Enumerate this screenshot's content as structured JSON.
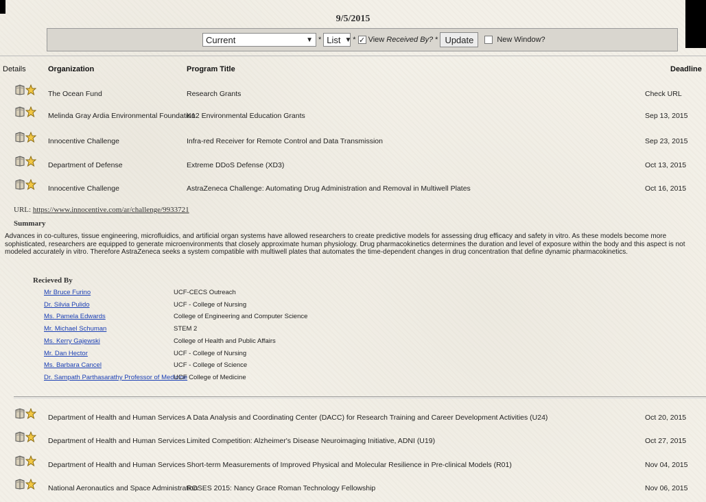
{
  "date": "9/5/2015",
  "toolbar": {
    "filter_value": "Current",
    "view_value": "List",
    "asterisk": "*",
    "view_received_label": "View",
    "view_received_italic": "Received By?",
    "update_label": "Update",
    "new_window_label": "New Window?"
  },
  "headers": {
    "details": "Details",
    "organization": "Organization",
    "program_title": "Program Title",
    "deadline": "Deadline"
  },
  "rows_top": [
    {
      "org": "The Ocean Fund",
      "title": "Research Grants",
      "deadline": "Check URL"
    },
    {
      "org": "Melinda Gray Ardia Environmental Foundation",
      "title": "K12 Environmental Education Grants",
      "deadline": "Sep 13, 2015"
    },
    {
      "org": "Innocentive Challenge",
      "title": "Infra-red Receiver for Remote Control and Data Transmission",
      "deadline": "Sep 23, 2015"
    },
    {
      "org": "Department of Defense",
      "title": "Extreme DDoS Defense (XD3)",
      "deadline": "Oct 13, 2015"
    },
    {
      "org": "Innocentive Challenge",
      "title": "AstraZeneca Challenge: Automating Drug Administration and Removal in Multiwell Plates",
      "deadline": "Oct 16, 2015"
    }
  ],
  "detail": {
    "url_label": "URL:",
    "url": "https://www.innocentive.com/ar/challenge/9933721",
    "summary_heading": "Summary",
    "summary": "Advances in co-cultures, tissue engineering, microfluidics, and artificial organ systems have allowed researchers to create predictive models for assessing drug efficacy and safety in vitro. As these models become more sophisticated, researchers are equipped to generate microenvironments that closely approximate human physiology. Drug pharmacokinetics determines the duration and level of exposure within the body and this aspect is not modeled accurately in vitro. Therefore AstraZeneca seeks a system compatible with multiwell plates that automates the time-dependent changes in drug concentration that define dynamic pharmacokinetics.",
    "received_heading": "Recieved By",
    "received": [
      {
        "person": "Mr Bruce Furino",
        "dept": "UCF-CECS Outreach"
      },
      {
        "person": "Dr. Silvia Pulido",
        "dept": "UCF - College of Nursing"
      },
      {
        "person": "Ms. Pamela Edwards",
        "dept": "College of Engineering and Computer Science"
      },
      {
        "person": "Mr. Michael Schuman",
        "dept": "STEM 2"
      },
      {
        "person": "Ms. Kerry Gajewski",
        "dept": "College of Health and Public Affairs"
      },
      {
        "person": "Mr. Dan Hector",
        "dept": "UCF - College of Nursing"
      },
      {
        "person": "Ms. Barbara Cancel",
        "dept": "UCF - College of Science"
      },
      {
        "person": "Dr. Sampath Parthasarathy Professor of Medicine",
        "dept": "UCF College of Medicine"
      }
    ]
  },
  "rows_bottom": [
    {
      "org": "Department of Health and Human Services",
      "title": "A Data Analysis and Coordinating Center (DACC) for Research Training and Career Development Activities (U24)",
      "deadline": "Oct 20, 2015"
    },
    {
      "org": "Department of Health and Human Services",
      "title": "Limited Competition: Alzheimer's Disease Neuroimaging Initiative, ADNI (U19)",
      "deadline": "Oct 27, 2015"
    },
    {
      "org": "Department of Health and Human Services",
      "title": "Short-term Measurements of Improved Physical and Molecular Resilience in Pre-clinical Models (R01)",
      "deadline": "Nov 04, 2015"
    },
    {
      "org": "National Aeronautics and Space Administration",
      "title": "ROSES 2015: Nancy Grace Roman Technology Fellowship",
      "deadline": "Nov 06, 2015"
    }
  ],
  "colors": {
    "link": "#1a3fb5",
    "star": "#f2c744",
    "book": "#b9a98a"
  },
  "icons": [
    "book-icon",
    "star-icon",
    "chevron-down-icon",
    "checkbox-icon"
  ]
}
